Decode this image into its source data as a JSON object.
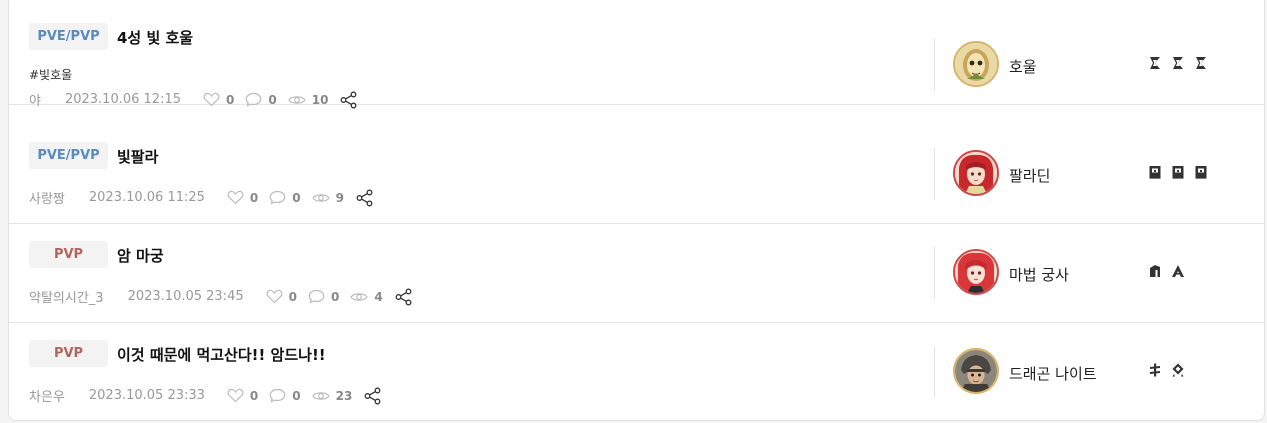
{
  "posts": [
    {
      "category": "PVE/PVP",
      "title": "4성 빛 호울",
      "hashtag": "#빛호울",
      "author": "야",
      "date": "2023.10.06 12:15",
      "likes": "0",
      "comments": "0",
      "views": "10",
      "class_name": "호울",
      "avatar_icon": "howl-avatar-icon",
      "marks": [
        "rune-zigzag-icon",
        "rune-zigzag-icon",
        "rune-zigzag-icon"
      ]
    },
    {
      "category": "PVE/PVP",
      "title": "빛팔라",
      "author": "사랑짱",
      "date": "2023.10.06 11:25",
      "likes": "0",
      "comments": "0",
      "views": "9",
      "class_name": "팔라딘",
      "avatar_icon": "paladin-avatar-icon",
      "marks": [
        "rune-box-icon",
        "rune-box-icon",
        "rune-box-icon"
      ]
    },
    {
      "category": "PVP",
      "title": "암 마궁",
      "author": "약탈의시간_3",
      "date": "2023.10.05 23:45",
      "likes": "0",
      "comments": "0",
      "views": "4",
      "class_name": "마법 궁사",
      "avatar_icon": "magic-archer-avatar-icon",
      "marks": [
        "rune-tower-icon",
        "rune-arrow-icon"
      ]
    },
    {
      "category": "PVP",
      "title": "이것 때문에 먹고산다!! 암드나!!",
      "author": "차은우",
      "date": "2023.10.05 23:33",
      "likes": "0",
      "comments": "0",
      "views": "23",
      "class_name": "드래곤 나이트",
      "avatar_icon": "dragon-knight-avatar-icon",
      "marks": [
        "rune-cross-icon",
        "rune-diamond-icon"
      ]
    }
  ],
  "colors": {
    "pvepvp_tag": "#5a8bbf",
    "pvp_tag": "#b0665f",
    "meta_text": "#999999",
    "avatar_border": "#d8b36a"
  }
}
